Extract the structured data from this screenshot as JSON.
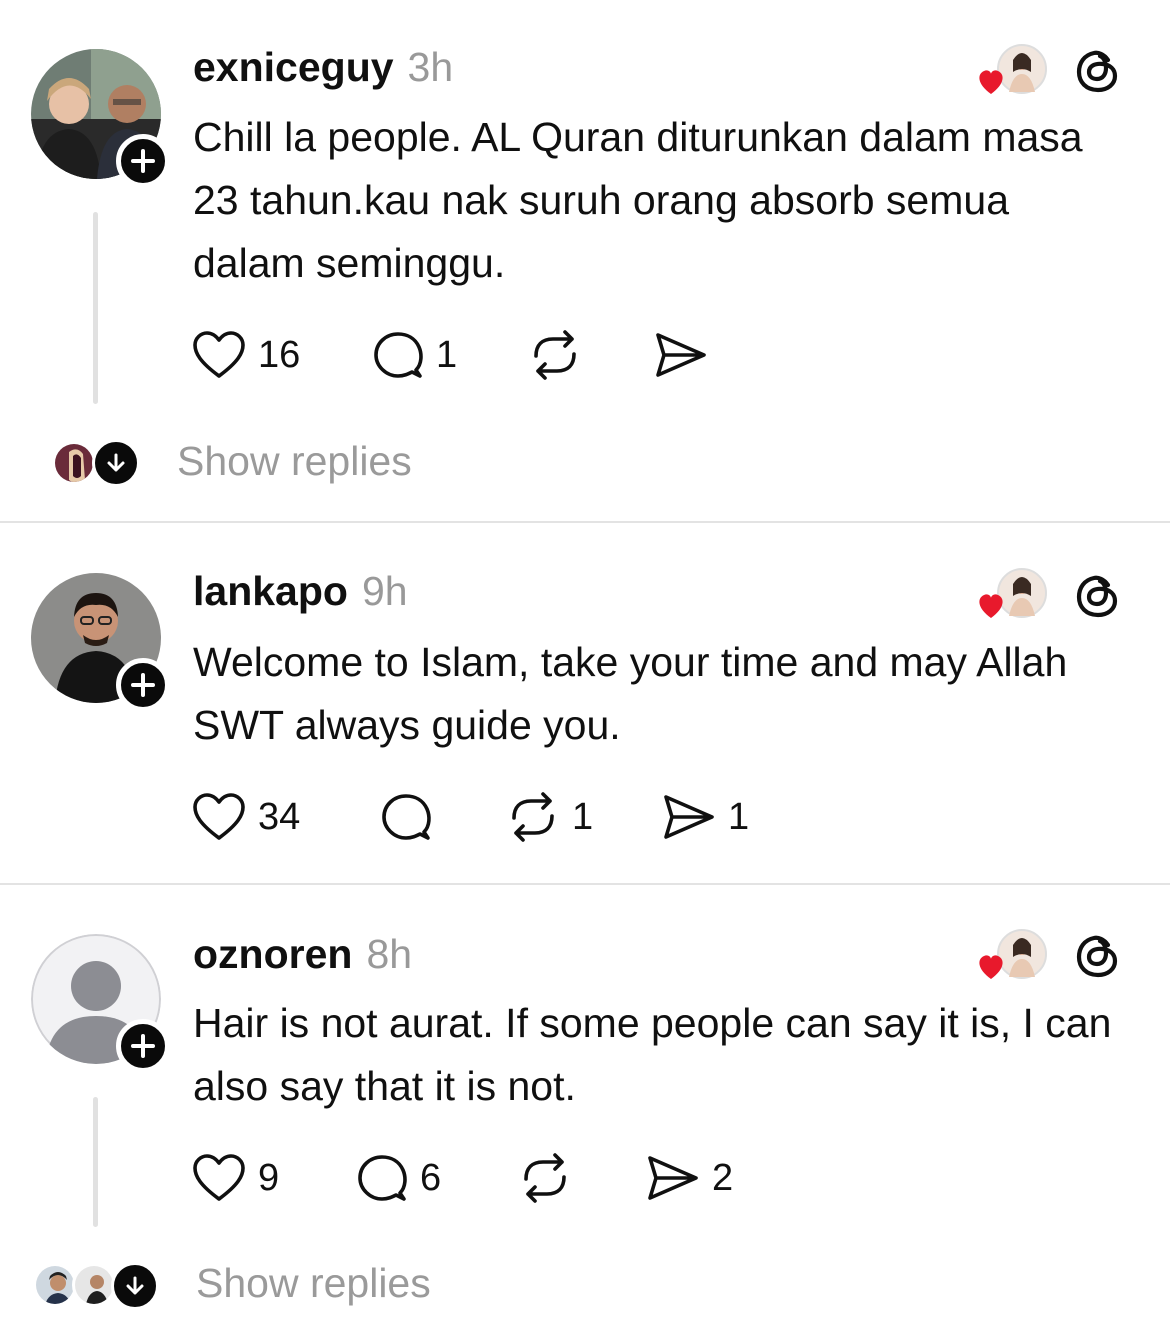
{
  "colors": {
    "text": "#101010",
    "muted": "#999999",
    "heart_red": "#e8192c",
    "divider": "#e3e3e3"
  },
  "posts": [
    {
      "username": "exniceguy",
      "time": "3h",
      "text": "Chill la people. AL Quran diturunkan dalam masa 23 tahun.kau nak suruh orang absorb semua dalam seminggu.",
      "likes": "16",
      "replies": "1",
      "reposts": "",
      "shares": "",
      "show_replies": "Show replies"
    },
    {
      "username": "lankapo",
      "time": "9h",
      "text": "Welcome to Islam, take your time and may Allah SWT always guide you.",
      "likes": "34",
      "replies": "",
      "reposts": "1",
      "shares": "1"
    },
    {
      "username": "oznoren",
      "time": "8h",
      "text": "Hair is not aurat.  If some people can say it is, I can also say that it is not.",
      "likes": "9",
      "replies": "6",
      "reposts": "",
      "shares": "2",
      "show_replies": "Show replies"
    }
  ],
  "icons": {
    "avatar_badge": "plus-icon",
    "like": "heart-icon",
    "reply": "comment-bubble-icon",
    "repost": "repost-icon",
    "share": "send-icon",
    "liked_by_author": "heart-with-avatar-icon",
    "app": "threads-logo-icon",
    "expand": "arrow-down-icon"
  }
}
